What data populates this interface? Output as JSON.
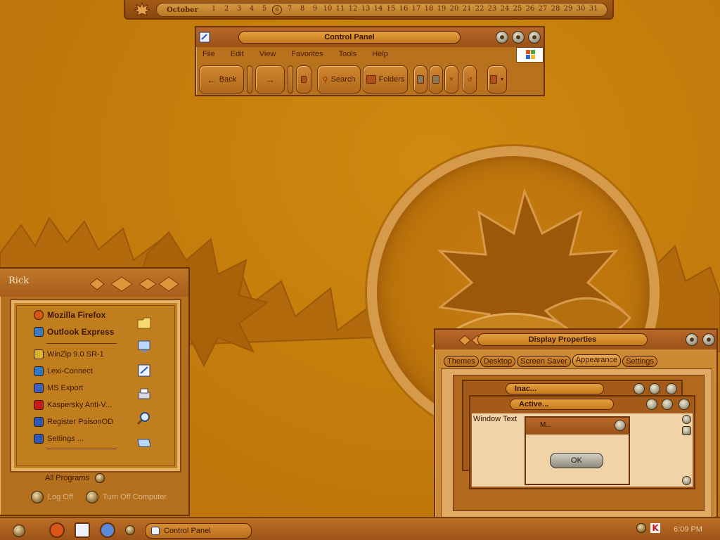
{
  "calendar": {
    "month": "October",
    "days": [
      "1",
      "2",
      "3",
      "4",
      "5",
      "6",
      "7",
      "8",
      "9",
      "10",
      "11",
      "12",
      "13",
      "14",
      "15",
      "16",
      "17",
      "18",
      "19",
      "20",
      "21",
      "22",
      "23",
      "24",
      "25",
      "26",
      "27",
      "28",
      "29",
      "30",
      "31"
    ],
    "today": "6"
  },
  "control_panel": {
    "title": "Control Panel",
    "menu": [
      "File",
      "Edit",
      "View",
      "Favorites",
      "Tools",
      "Help"
    ],
    "toolbar": {
      "back": "Back",
      "search": "Search",
      "folders": "Folders"
    }
  },
  "start_menu": {
    "user": "Rick",
    "pinned": [
      {
        "label": "Mozilla Firefox",
        "icon": "firefox-icon",
        "color": "#d8561a"
      },
      {
        "label": "Outlook Express",
        "icon": "outlook-express-icon",
        "color": "#3a78c8"
      }
    ],
    "recent": [
      {
        "label": "WinZip 9.0 SR-1",
        "icon": "winzip-icon",
        "color": "#d8b428"
      },
      {
        "label": "Lexi-Connect",
        "icon": "lexi-connect-icon",
        "color": "#2a7ac8"
      },
      {
        "label": "MS Export",
        "icon": "ms-export-icon",
        "color": "#3a62c0"
      },
      {
        "label": "Kaspersky Anti-V...",
        "icon": "kaspersky-icon",
        "color": "#c81c1c"
      },
      {
        "label": "Register PoisonOD",
        "icon": "register-icon",
        "color": "#2a5ab8"
      },
      {
        "label": "Settings ...",
        "icon": "settings-icon",
        "color": "#2a5ab8"
      }
    ],
    "places_icons": [
      "my-documents-icon",
      "my-computer-icon",
      "control-panel-icon",
      "printers-icon",
      "search-icon",
      "run-icon"
    ],
    "all_programs": "All Programs",
    "log_off": "Log Off",
    "turn_off": "Turn Off Computer"
  },
  "display_properties": {
    "title": "Display Properties",
    "tabs": [
      "Themes",
      "Desktop",
      "Screen Saver",
      "Appearance",
      "Settings"
    ],
    "active_tab": "Appearance",
    "preview": {
      "inactive_title": "Inac...",
      "active_title": "Active...",
      "window_text": "Window Text",
      "message_title": "M...",
      "ok_label": "OK"
    }
  },
  "taskbar": {
    "task_label": "Control Panel",
    "clock": "6:09 PM"
  }
}
